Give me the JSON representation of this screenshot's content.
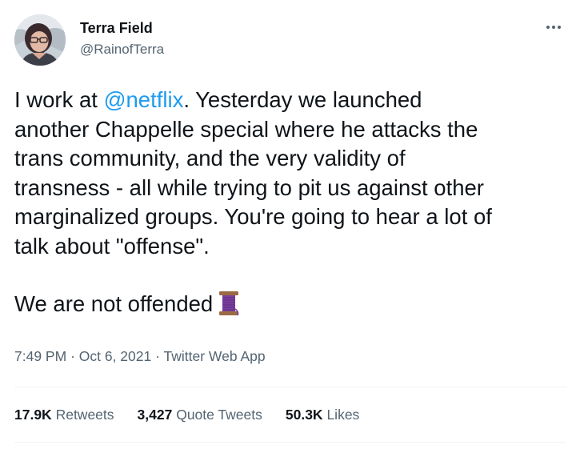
{
  "author": {
    "display_name": "Terra Field",
    "handle": "@RainofTerra"
  },
  "tweet": {
    "lines": [
      {
        "before": "I work at ",
        "mention": "@netflix",
        "after": ". Yesterday we launched"
      },
      {
        "text": "another Chappelle special where he attacks the"
      },
      {
        "text": "trans community, and the very validity of"
      },
      {
        "text": "transness - all while trying to pit us against other"
      },
      {
        "text": "marginalized groups. You're going to hear a lot of"
      },
      {
        "text": "talk about \"offense\"."
      }
    ],
    "closing_line": "We are not offended",
    "closing_emoji": "thread-spool-emoji"
  },
  "meta": {
    "time": "7:49 PM",
    "separator": "·",
    "date": "Oct 6, 2021",
    "source": "Twitter Web App"
  },
  "stats": {
    "retweets_count": "17.9K",
    "retweets_label": "Retweets",
    "quote_count": "3,427",
    "quote_label": "Quote Tweets",
    "likes_count": "50.3K",
    "likes_label": "Likes"
  },
  "colors": {
    "link": "#1d9bf0",
    "secondary_text": "#536471",
    "primary_text": "#0f1419",
    "divider": "#eff3f4",
    "emoji_thread": "#7b3fa0"
  },
  "icons": {
    "more": "more-horizontal-icon",
    "emoji": "thread-spool-emoji"
  }
}
